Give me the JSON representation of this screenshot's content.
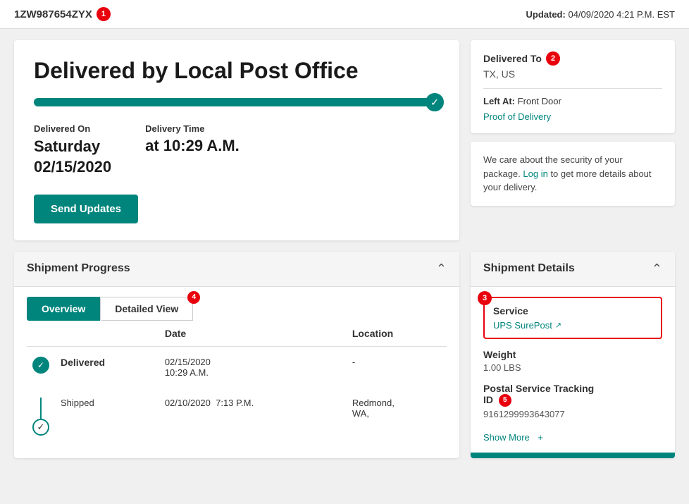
{
  "topBar": {
    "trackingNumber": "1ZW987654ZYX",
    "badge1": "1",
    "updatedLabel": "Updated:",
    "updatedValue": "04/09/2020 4:21 P.M. EST"
  },
  "deliveryCard": {
    "title": "Delivered by Local Post Office",
    "deliveredOnLabel": "Delivered On",
    "deliveryDate": "Saturday\n02/15/2020",
    "deliveryTimeLabel": "Delivery Time",
    "deliveryTime": "at 10:29 A.M.",
    "sendUpdatesBtn": "Send Updates"
  },
  "rightSidebar": {
    "deliveredToLabel": "Delivered To",
    "badge2": "2",
    "address": "TX, US",
    "leftAtLabel": "Left At:",
    "leftAtValue": "Front Door",
    "proofLink": "Proof of Delivery",
    "securityText": "We care about the security of your package.",
    "loginLink": "Log in",
    "securitySuffix": "to get more details about your delivery."
  },
  "shipmentProgress": {
    "title": "Shipment Progress",
    "tabs": [
      {
        "label": "Overview",
        "active": true
      },
      {
        "label": "Detailed View",
        "active": false,
        "badge": "4"
      }
    ],
    "tableHeaders": {
      "status": "",
      "date": "Date",
      "location": "Location"
    },
    "rows": [
      {
        "status": "Delivered",
        "date": "02/15/2020",
        "time": "10:29 A.M.",
        "location": "-",
        "iconType": "check"
      },
      {
        "status": "Shipped",
        "date": "02/10/2020",
        "time": "7:13 P.M.",
        "location": "Redmond, WA,",
        "iconType": "outline-check"
      }
    ]
  },
  "shipmentDetails": {
    "title": "Shipment Details",
    "serviceLabel": "Service",
    "serviceValue": "UPS SurePost",
    "badge3": "3",
    "weightLabel": "Weight",
    "weightValue": "1.00 LBS",
    "postalLabel": "Postal Service Tracking",
    "postalLabel2": "ID",
    "postalValue": "9161299993643077",
    "badge5": "5",
    "showMore": "Show More",
    "plusSign": "+"
  }
}
